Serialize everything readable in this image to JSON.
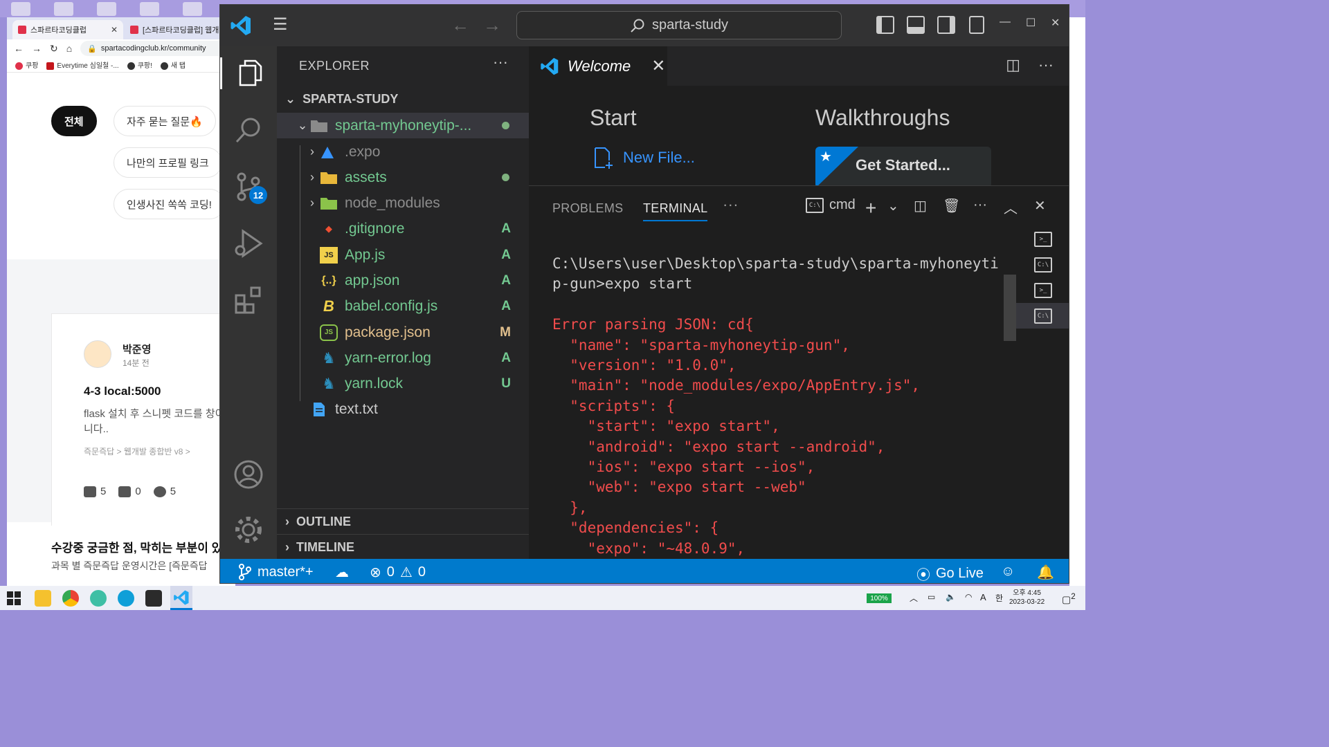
{
  "browser": {
    "tabs": [
      {
        "title": "스파르타코딩클럽",
        "active": true
      },
      {
        "title": "[스파르타코딩클럽] 웹개",
        "active": false
      }
    ],
    "url": "spartacodingclub.kr/community",
    "bookmarks": [
      "쿠팡",
      "Everytime 심일철 -...",
      "쿠팡!",
      "새 탭"
    ],
    "chips": [
      "전체",
      "자주 묻는 질문🔥",
      "나만의 프로필 링크",
      "인생사진 쏙쏙 코딩!"
    ],
    "post": {
      "author": "박준영",
      "time": "14분 전",
      "title": "4-3 local:5000",
      "body": "flask 설치 후 스니펫 코드를 창이 안뜹니다..",
      "category": "즉문즉답 > 웹개발 종합반 v8 >",
      "comments": "5",
      "likes": "0",
      "views": "5"
    },
    "notice": {
      "title": "수강중 궁금한 점, 막히는 부분이 있",
      "subtitle": "과목 별 즉문즉답 운영시간은 [즉문즉답"
    }
  },
  "vscode": {
    "search": "sparta-study",
    "activity": {
      "scm_badge": "12"
    },
    "explorer": {
      "header": "EXPLORER",
      "root": "SPARTA-STUDY",
      "folder": "sparta-myhoneytip-...",
      "items": [
        {
          "name": ".expo",
          "type": "folder",
          "status": "",
          "color": "#3794ff"
        },
        {
          "name": "assets",
          "type": "folder",
          "status": "dot",
          "color": "#73c991"
        },
        {
          "name": "node_modules",
          "type": "folder",
          "status": "",
          "color": "#8c8c8c"
        },
        {
          "name": ".gitignore",
          "type": "file",
          "status": "A",
          "color": "#73c991"
        },
        {
          "name": "App.js",
          "type": "file",
          "status": "A",
          "color": "#73c991"
        },
        {
          "name": "app.json",
          "type": "file",
          "status": "A",
          "color": "#73c991"
        },
        {
          "name": "babel.config.js",
          "type": "file",
          "status": "A",
          "color": "#73c991"
        },
        {
          "name": "package.json",
          "type": "file",
          "status": "M",
          "color": "#e2c08d"
        },
        {
          "name": "yarn-error.log",
          "type": "file",
          "status": "A",
          "color": "#73c991"
        },
        {
          "name": "yarn.lock",
          "type": "file",
          "status": "U",
          "color": "#73c991"
        }
      ],
      "outside": "text.txt",
      "outline": "OUTLINE",
      "timeline": "TIMELINE"
    },
    "editor": {
      "tab": "Welcome",
      "start": "Start",
      "walkthroughs": "Walkthroughs",
      "new_file": "New File...",
      "get_started": "Get Started..."
    },
    "panel": {
      "tabs": [
        "PROBLEMS",
        "TERMINAL"
      ],
      "shell": "cmd",
      "lines": [
        {
          "text": "C:\\Users\\user\\Desktop\\sparta-study\\sparta-myhoneyti",
          "err": false
        },
        {
          "text": "p-gun>expo start",
          "err": false
        },
        {
          "text": "",
          "err": false
        },
        {
          "text": "Error parsing JSON: cd{",
          "err": true
        },
        {
          "text": "  \"name\": \"sparta-myhoneytip-gun\",",
          "err": true
        },
        {
          "text": "  \"version\": \"1.0.0\",",
          "err": true
        },
        {
          "text": "  \"main\": \"node_modules/expo/AppEntry.js\",",
          "err": true
        },
        {
          "text": "  \"scripts\": {",
          "err": true
        },
        {
          "text": "    \"start\": \"expo start\",",
          "err": true
        },
        {
          "text": "    \"android\": \"expo start --android\",",
          "err": true
        },
        {
          "text": "    \"ios\": \"expo start --ios\",",
          "err": true
        },
        {
          "text": "    \"web\": \"expo start --web\"",
          "err": true
        },
        {
          "text": "  },",
          "err": true
        },
        {
          "text": "  \"dependencies\": {",
          "err": true
        },
        {
          "text": "    \"expo\": \"~48.0.9\",",
          "err": true
        }
      ]
    },
    "status": {
      "branch": "master*+",
      "errors": "0",
      "warnings": "0",
      "go_live": "Go Live"
    }
  },
  "taskbar": {
    "battery": "100%",
    "ime": "A",
    "lang": "한",
    "time": "오후 4:45",
    "date": "2023-03-22",
    "notifications": "2"
  }
}
